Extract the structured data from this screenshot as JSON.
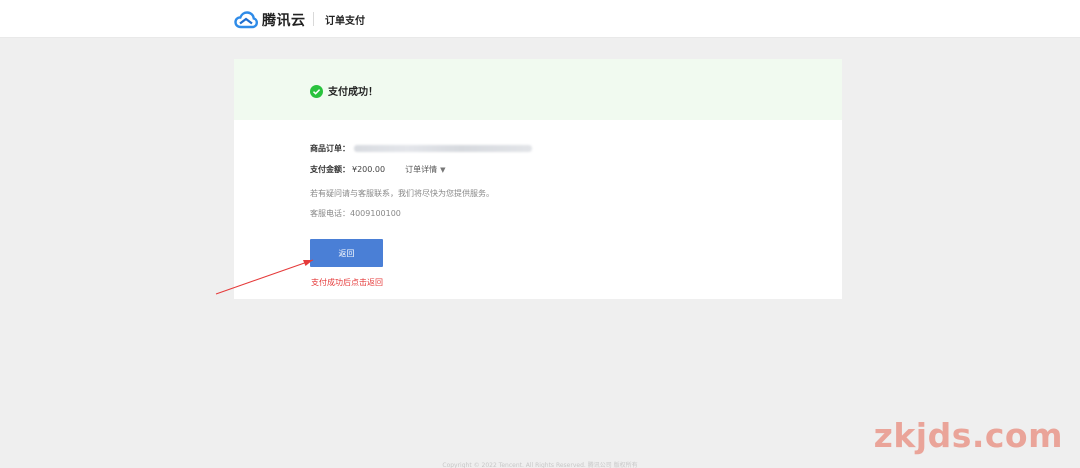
{
  "header": {
    "brand_name": "腾讯云",
    "page_title": "订单支付"
  },
  "success": {
    "message": "支付成功！"
  },
  "order": {
    "order_label": "商品订单：",
    "amount_label": "支付金额：",
    "amount_value": "¥200.00",
    "detail_link": "订单详情",
    "caret": "▼"
  },
  "info": {
    "notice": "若有疑问请与客服联系，我们将尽快为您提供服务。",
    "phone_label": "客服电话：",
    "phone_value": "4009100100"
  },
  "actions": {
    "return_label": "返回"
  },
  "annotation": {
    "text": "支付成功后点击返回",
    "color": "#e53a3a"
  },
  "footer": {
    "copyright": "Copyright © 2022 Tencent. All Rights Reserved. 腾讯公司 版权所有"
  },
  "watermark": {
    "text": "zkjds.com"
  },
  "colors": {
    "accent": "#4a7fd6",
    "success_bg": "#f1faf0",
    "success_icon": "#29c23d",
    "page_bg": "#efefef"
  }
}
